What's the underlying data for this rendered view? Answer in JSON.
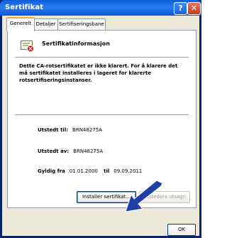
{
  "window": {
    "title": "Sertifikat"
  },
  "titlebar": {
    "help_glyph": "?",
    "close_glyph": "✕"
  },
  "tabs": [
    {
      "label": "Generelt"
    },
    {
      "label": "Detaljer"
    },
    {
      "label": "Sertifiseringsbane"
    }
  ],
  "info": {
    "title": "Sertifikatinformasjon",
    "warning": "Dette CA-rotsertifikatet er ikke klarert. For å klarere det må sertifikatet installeres i lageret for klarerte rotsertifiseringsinstanser."
  },
  "details": {
    "issued_to_label": "Utstedt til:",
    "issued_to": "BRN48275A",
    "issued_by_label": "Utstedt av:",
    "issued_by": "BRN48275A",
    "valid_from_label": "Gyldig fra",
    "valid_from": "01.01.2000",
    "valid_to_label": "til",
    "valid_to": "09.09.2011"
  },
  "buttons": {
    "install": "Installer sertifikat...",
    "issuer_statement": "Utsteders utsagn",
    "ok": "OK"
  },
  "colors": {
    "titlebar": "#0a5ed8",
    "frame": "#ece9d8",
    "arrow": "#1f3fa6"
  },
  "icons": {
    "certificate": "certificate-icon",
    "arrow": "pointer-arrow-icon"
  }
}
